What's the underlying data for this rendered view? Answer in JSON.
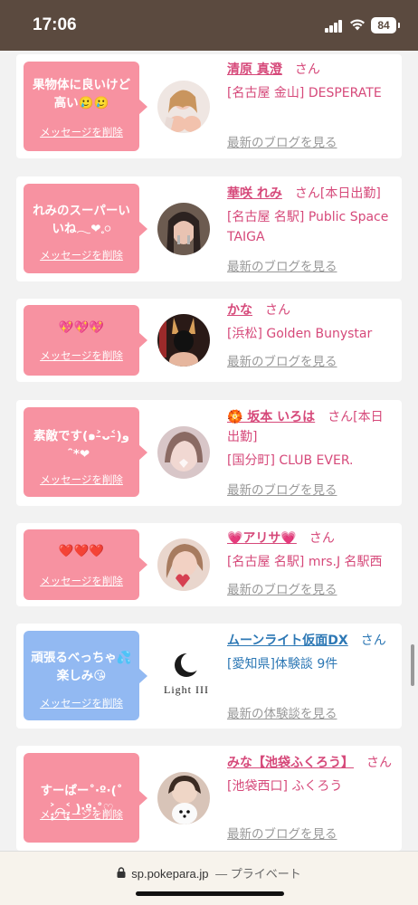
{
  "status_bar": {
    "time": "17:06",
    "battery": "84"
  },
  "cards": [
    {
      "bubble_color": "pink",
      "message": "果物体に良いけど高い🥲🥲",
      "delete_label": "メッセージを削除",
      "name": "清原 真澄",
      "san": "さん",
      "shop": "[名古屋 金山] DESPERATE",
      "link": "最新のブログを見る",
      "name_color": "pink"
    },
    {
      "bubble_color": "pink",
      "message": "れみのスーパーいいね𓂃❤︎𓈒𓏸",
      "delete_label": "メッセージを削除",
      "name": "華咲 れみ",
      "san": "さん[本日出勤]",
      "shop": "[名古屋 名駅] Public Space TAIGA",
      "link": "最新のブログを見る",
      "name_color": "pink"
    },
    {
      "bubble_color": "pink",
      "message": "💖💖💖",
      "delete_label": "メッセージを削除",
      "name": "かな",
      "san": "さん",
      "shop": "[浜松] Golden Bunystar",
      "link": "最新のブログを見る",
      "name_color": "pink"
    },
    {
      "bubble_color": "pink",
      "message": "素敵です(๑˃̵ᴗ˂̵)و ̑̑*❤",
      "delete_label": "メッセージを削除",
      "name": "🏵️ 坂本 いろは",
      "san": "さん[本日出勤]",
      "shop": "[国分町] CLUB EVER.",
      "link": "最新のブログを見る",
      "name_color": "pink"
    },
    {
      "bubble_color": "pink",
      "message": "❤️❤️❤️",
      "delete_label": "メッセージを削除",
      "name": "💗アリサ💗",
      "san": "さん",
      "shop": "[名古屋 名駅] mrs.J 名駅西",
      "link": "最新のブログを見る",
      "name_color": "pink"
    },
    {
      "bubble_color": "blue",
      "message": "頑張るべっちゃ💦楽しみ😘",
      "delete_label": "メッセージを削除",
      "name": "ムーンライト仮面DX",
      "san": "さん",
      "shop": "[愛知県]体験談 9件",
      "link": "最新の体験談を見る",
      "name_color": "blue",
      "logo_text": "Light III"
    },
    {
      "bubble_color": "pink",
      "message": "すーぱー˚‧º·(˚ ˃̣̣̥⌓˂̣̣̥ )‧º·˚♡",
      "delete_label": "メッセージを削除",
      "name": "みな【池袋ふくろう】",
      "san": "さん",
      "shop": "[池袋西口] ふくろう",
      "link": "最新のブログを見る",
      "name_color": "pink"
    }
  ],
  "url_bar": {
    "domain": "sp.pokepara.jp",
    "mode": "— プライベート"
  },
  "colors": {
    "pink_bubble": "#f792a1",
    "blue_bubble": "#92b9f2",
    "pink_text": "#d6497a",
    "blue_text": "#2d78b5",
    "status_bar_bg": "#5b4a3f"
  }
}
